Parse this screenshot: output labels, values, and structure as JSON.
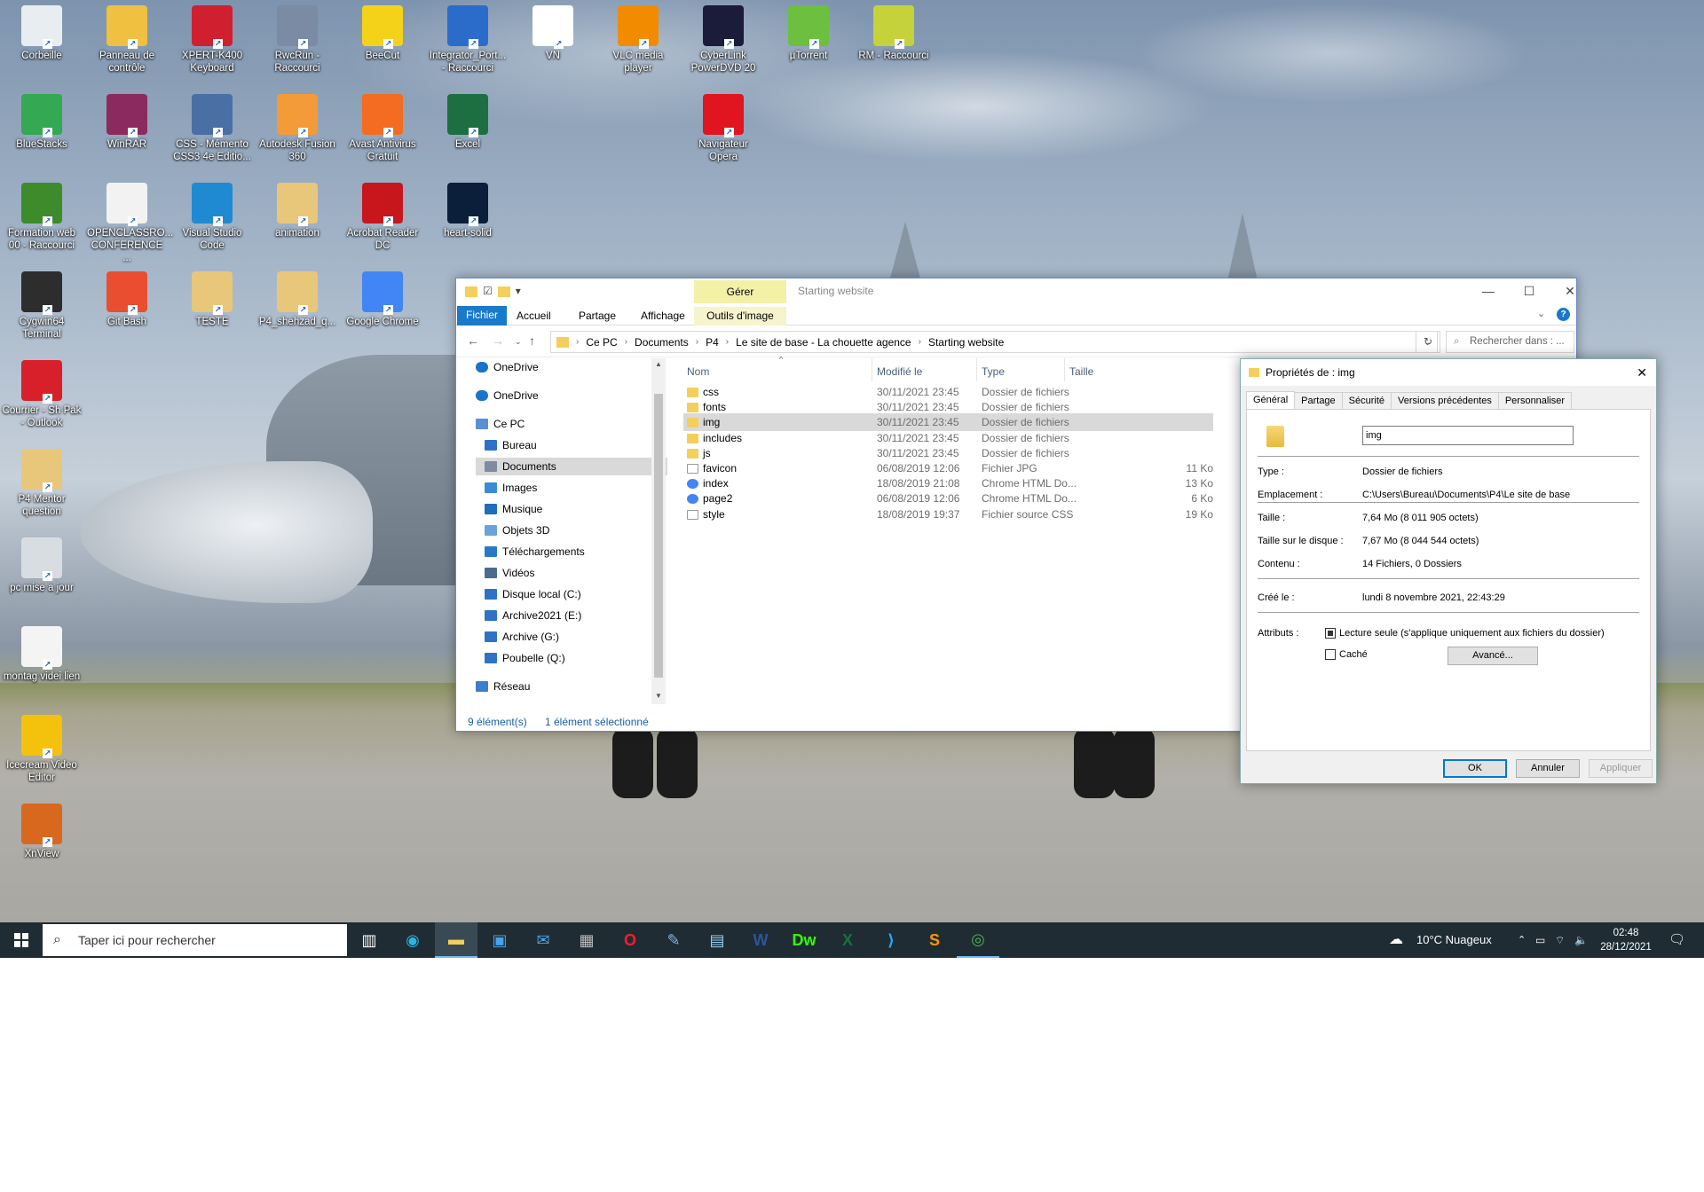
{
  "desktop_icons": [
    {
      "label": "Corbeille",
      "icon": "recycle-bin-icon",
      "color": "#e8edf2"
    },
    {
      "label": "Panneau de contrôle",
      "icon": "control-panel-icon",
      "color": "#f0c040"
    },
    {
      "label": "XPERT-K400 Keyboard",
      "icon": "keyboard-app-icon",
      "color": "#d02030"
    },
    {
      "label": "RwcRun - Raccourci",
      "icon": "rwcrun-icon",
      "color": "#7a8ba3"
    },
    {
      "label": "BeeCut",
      "icon": "beecut-icon",
      "color": "#f4d21a"
    },
    {
      "label": "Integrator_Port... - Raccourci",
      "icon": "integrator-icon",
      "color": "#2b6ccb"
    },
    {
      "label": "VN",
      "icon": "vn-icon",
      "color": "#ffffff"
    },
    {
      "label": "VLC media player",
      "icon": "vlc-icon",
      "color": "#f28b00"
    },
    {
      "label": "CyberLink PowerDVD 20",
      "icon": "powerdvd-icon",
      "color": "#1b1b3a"
    },
    {
      "label": "µTorrent",
      "icon": "utorrent-icon",
      "color": "#6cbf3f"
    },
    {
      "label": "RM - Raccourci",
      "icon": "radiomaster-icon",
      "color": "#c5d23a"
    },
    {
      "label": "BlueStacks",
      "icon": "bluestacks-icon",
      "color": "#35a853"
    },
    {
      "label": "WinRAR",
      "icon": "winrar-icon",
      "color": "#8b2a5e"
    },
    {
      "label": "CSS - Mémento CSS3 4e Editio...",
      "icon": "epub-icon",
      "color": "#4a6fa5"
    },
    {
      "label": "Autodesk Fusion 360",
      "icon": "fusion360-icon",
      "color": "#f29b38"
    },
    {
      "label": "Avast Antivirus Gratuit",
      "icon": "avast-icon",
      "color": "#f36c21"
    },
    {
      "label": "Excel",
      "icon": "excel-icon",
      "color": "#1d6f42"
    },
    {
      "label": "Navigateur Opera",
      "icon": "opera-icon",
      "color": "#e0151f"
    },
    {
      "label": "Formation web 00 - Raccourci",
      "icon": "tree-icon",
      "color": "#3d8b2a"
    },
    {
      "label": "OPENCLASSRO... CONFERENCE ...",
      "icon": "document-icon",
      "color": "#f2f2f2"
    },
    {
      "label": "Visual Studio Code",
      "icon": "vscode-icon",
      "color": "#1f8ad2"
    },
    {
      "label": "animation",
      "icon": "zip-folder-icon",
      "color": "#e8c77a"
    },
    {
      "label": "Acrobat Reader DC",
      "icon": "acrobat-icon",
      "color": "#c8161d"
    },
    {
      "label": "heart-solid",
      "icon": "photoshop-icon",
      "color": "#0b1f3a"
    },
    {
      "label": "Cygwin64 Terminal",
      "icon": "cygwin-icon",
      "color": "#2d2d2d"
    },
    {
      "label": "Git Bash",
      "icon": "git-bash-icon",
      "color": "#e94e31"
    },
    {
      "label": "TESTE",
      "icon": "zip-folder-icon",
      "color": "#e8c77a"
    },
    {
      "label": "P4_shehzad_q...",
      "icon": "zip-folder-icon",
      "color": "#e8c77a"
    },
    {
      "label": "Google Chrome",
      "icon": "chrome-icon",
      "color": "#4285f4"
    },
    {
      "label": "Courrier - Sh Pak - Outlook",
      "icon": "pdf-icon",
      "color": "#d8202a"
    },
    {
      "label": "P4 Mentor question",
      "icon": "zip-folder-icon",
      "color": "#e8c77a"
    },
    {
      "label": "pc mise a jour",
      "icon": "computer-icon",
      "color": "#d8dde2"
    },
    {
      "label": "montag videi lien",
      "icon": "text-file-icon",
      "color": "#f4f4f4"
    },
    {
      "label": "Icecream Video Editor",
      "icon": "icecream-icon",
      "color": "#f4c20d"
    },
    {
      "label": "XnView",
      "icon": "xnview-icon",
      "color": "#d9681f"
    }
  ],
  "explorer": {
    "title": "Starting website",
    "manage_tab": "Gérer",
    "ribbon_tabs": [
      "Fichier",
      "Accueil",
      "Partage",
      "Affichage",
      "Outils d'image"
    ],
    "path": [
      "Ce PC",
      "Documents",
      "P4",
      "Le site de base - La chouette agence",
      "Starting website"
    ],
    "search_placeholder": "Rechercher dans : ...",
    "nav": [
      "OneDrive",
      "OneDrive",
      "Ce PC",
      "Bureau",
      "Documents",
      "Images",
      "Musique",
      "Objets 3D",
      "Téléchargements",
      "Vidéos",
      "Disque local (C:)",
      "Archive2021 (E:)",
      "Archive (G:)",
      "Poubelle (Q:)",
      "Réseau"
    ],
    "columns": {
      "name": "Nom",
      "modified": "Modifié le",
      "type": "Type",
      "size": "Taille"
    },
    "files": [
      {
        "name": "css",
        "modified": "30/11/2021 23:45",
        "type": "Dossier de fichiers",
        "size": "",
        "kind": "folder"
      },
      {
        "name": "fonts",
        "modified": "30/11/2021 23:45",
        "type": "Dossier de fichiers",
        "size": "",
        "kind": "folder"
      },
      {
        "name": "img",
        "modified": "30/11/2021 23:45",
        "type": "Dossier de fichiers",
        "size": "",
        "kind": "folder"
      },
      {
        "name": "includes",
        "modified": "30/11/2021 23:45",
        "type": "Dossier de fichiers",
        "size": "",
        "kind": "folder"
      },
      {
        "name": "js",
        "modified": "30/11/2021 23:45",
        "type": "Dossier de fichiers",
        "size": "",
        "kind": "folder"
      },
      {
        "name": "favicon",
        "modified": "06/08/2019 12:06",
        "type": "Fichier JPG",
        "size": "11 Ko",
        "kind": "image"
      },
      {
        "name": "index",
        "modified": "18/08/2019 21:08",
        "type": "Chrome HTML Do...",
        "size": "13 Ko",
        "kind": "chrome"
      },
      {
        "name": "page2",
        "modified": "06/08/2019 12:06",
        "type": "Chrome HTML Do...",
        "size": "6 Ko",
        "kind": "chrome"
      },
      {
        "name": "style",
        "modified": "18/08/2019 19:37",
        "type": "Fichier source CSS",
        "size": "19 Ko",
        "kind": "css"
      }
    ],
    "selected_file": "img",
    "status_count": "9 élément(s)",
    "status_selected": "1 élément sélectionné"
  },
  "properties": {
    "title": "Propriétés de : img",
    "tabs": [
      "Général",
      "Partage",
      "Sécurité",
      "Versions précédentes",
      "Personnaliser"
    ],
    "name_value": "img",
    "type_label": "Type :",
    "type_value": "Dossier de fichiers",
    "location_label": "Emplacement :",
    "location_value": "C:\\Users\\Bureau\\Documents\\P4\\Le site de base",
    "size_label": "Taille :",
    "size_value": "7,64 Mo (8 011 905 octets)",
    "disk_label": "Taille sur le disque :",
    "disk_value": "7,67 Mo (8 044 544 octets)",
    "contents_label": "Contenu :",
    "contents_value": "14 Fichiers, 0 Dossiers",
    "created_label": "Créé le :",
    "created_value": "lundi 8 novembre 2021, 22:43:29",
    "attributes_label": "Attributs :",
    "readonly_label": "Lecture seule (s'applique uniquement aux fichiers du dossier)",
    "hidden_label": "Caché",
    "advanced_label": "Avancé...",
    "ok_label": "OK",
    "cancel_label": "Annuler",
    "apply_label": "Appliquer"
  },
  "taskbar": {
    "search_placeholder": "Taper ici pour rechercher",
    "weather": "10°C  Nuageux",
    "time": "02:48",
    "date": "28/12/2021",
    "pinned": [
      "task-view-icon",
      "edge-icon",
      "file-explorer-icon",
      "store-icon",
      "mail-icon",
      "calculator-icon",
      "opera-icon",
      "paint-icon",
      "notepad-icon",
      "word-icon",
      "dreamweaver-icon",
      "excel-icon",
      "vscode-icon",
      "sublime-icon",
      "chrome-icon"
    ]
  }
}
